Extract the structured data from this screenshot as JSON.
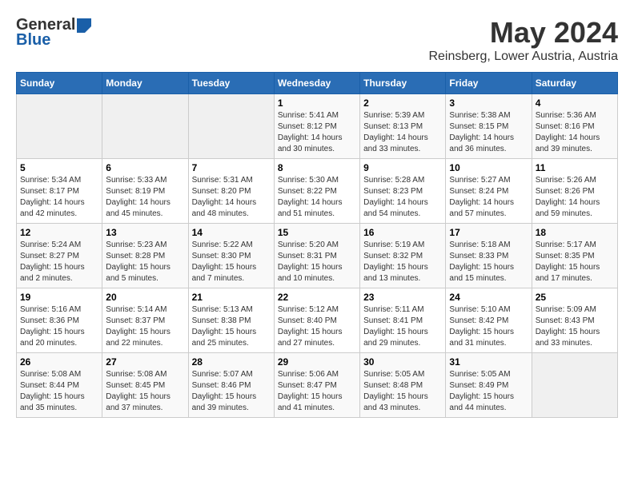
{
  "header": {
    "logo_general": "General",
    "logo_blue": "Blue",
    "title": "May 2024",
    "subtitle": "Reinsberg, Lower Austria, Austria"
  },
  "days_of_week": [
    "Sunday",
    "Monday",
    "Tuesday",
    "Wednesday",
    "Thursday",
    "Friday",
    "Saturday"
  ],
  "weeks": [
    [
      {
        "day": "",
        "info": ""
      },
      {
        "day": "",
        "info": ""
      },
      {
        "day": "",
        "info": ""
      },
      {
        "day": "1",
        "info": "Sunrise: 5:41 AM\nSunset: 8:12 PM\nDaylight: 14 hours\nand 30 minutes."
      },
      {
        "day": "2",
        "info": "Sunrise: 5:39 AM\nSunset: 8:13 PM\nDaylight: 14 hours\nand 33 minutes."
      },
      {
        "day": "3",
        "info": "Sunrise: 5:38 AM\nSunset: 8:15 PM\nDaylight: 14 hours\nand 36 minutes."
      },
      {
        "day": "4",
        "info": "Sunrise: 5:36 AM\nSunset: 8:16 PM\nDaylight: 14 hours\nand 39 minutes."
      }
    ],
    [
      {
        "day": "5",
        "info": "Sunrise: 5:34 AM\nSunset: 8:17 PM\nDaylight: 14 hours\nand 42 minutes."
      },
      {
        "day": "6",
        "info": "Sunrise: 5:33 AM\nSunset: 8:19 PM\nDaylight: 14 hours\nand 45 minutes."
      },
      {
        "day": "7",
        "info": "Sunrise: 5:31 AM\nSunset: 8:20 PM\nDaylight: 14 hours\nand 48 minutes."
      },
      {
        "day": "8",
        "info": "Sunrise: 5:30 AM\nSunset: 8:22 PM\nDaylight: 14 hours\nand 51 minutes."
      },
      {
        "day": "9",
        "info": "Sunrise: 5:28 AM\nSunset: 8:23 PM\nDaylight: 14 hours\nand 54 minutes."
      },
      {
        "day": "10",
        "info": "Sunrise: 5:27 AM\nSunset: 8:24 PM\nDaylight: 14 hours\nand 57 minutes."
      },
      {
        "day": "11",
        "info": "Sunrise: 5:26 AM\nSunset: 8:26 PM\nDaylight: 14 hours\nand 59 minutes."
      }
    ],
    [
      {
        "day": "12",
        "info": "Sunrise: 5:24 AM\nSunset: 8:27 PM\nDaylight: 15 hours\nand 2 minutes."
      },
      {
        "day": "13",
        "info": "Sunrise: 5:23 AM\nSunset: 8:28 PM\nDaylight: 15 hours\nand 5 minutes."
      },
      {
        "day": "14",
        "info": "Sunrise: 5:22 AM\nSunset: 8:30 PM\nDaylight: 15 hours\nand 7 minutes."
      },
      {
        "day": "15",
        "info": "Sunrise: 5:20 AM\nSunset: 8:31 PM\nDaylight: 15 hours\nand 10 minutes."
      },
      {
        "day": "16",
        "info": "Sunrise: 5:19 AM\nSunset: 8:32 PM\nDaylight: 15 hours\nand 13 minutes."
      },
      {
        "day": "17",
        "info": "Sunrise: 5:18 AM\nSunset: 8:33 PM\nDaylight: 15 hours\nand 15 minutes."
      },
      {
        "day": "18",
        "info": "Sunrise: 5:17 AM\nSunset: 8:35 PM\nDaylight: 15 hours\nand 17 minutes."
      }
    ],
    [
      {
        "day": "19",
        "info": "Sunrise: 5:16 AM\nSunset: 8:36 PM\nDaylight: 15 hours\nand 20 minutes."
      },
      {
        "day": "20",
        "info": "Sunrise: 5:14 AM\nSunset: 8:37 PM\nDaylight: 15 hours\nand 22 minutes."
      },
      {
        "day": "21",
        "info": "Sunrise: 5:13 AM\nSunset: 8:38 PM\nDaylight: 15 hours\nand 25 minutes."
      },
      {
        "day": "22",
        "info": "Sunrise: 5:12 AM\nSunset: 8:40 PM\nDaylight: 15 hours\nand 27 minutes."
      },
      {
        "day": "23",
        "info": "Sunrise: 5:11 AM\nSunset: 8:41 PM\nDaylight: 15 hours\nand 29 minutes."
      },
      {
        "day": "24",
        "info": "Sunrise: 5:10 AM\nSunset: 8:42 PM\nDaylight: 15 hours\nand 31 minutes."
      },
      {
        "day": "25",
        "info": "Sunrise: 5:09 AM\nSunset: 8:43 PM\nDaylight: 15 hours\nand 33 minutes."
      }
    ],
    [
      {
        "day": "26",
        "info": "Sunrise: 5:08 AM\nSunset: 8:44 PM\nDaylight: 15 hours\nand 35 minutes."
      },
      {
        "day": "27",
        "info": "Sunrise: 5:08 AM\nSunset: 8:45 PM\nDaylight: 15 hours\nand 37 minutes."
      },
      {
        "day": "28",
        "info": "Sunrise: 5:07 AM\nSunset: 8:46 PM\nDaylight: 15 hours\nand 39 minutes."
      },
      {
        "day": "29",
        "info": "Sunrise: 5:06 AM\nSunset: 8:47 PM\nDaylight: 15 hours\nand 41 minutes."
      },
      {
        "day": "30",
        "info": "Sunrise: 5:05 AM\nSunset: 8:48 PM\nDaylight: 15 hours\nand 43 minutes."
      },
      {
        "day": "31",
        "info": "Sunrise: 5:05 AM\nSunset: 8:49 PM\nDaylight: 15 hours\nand 44 minutes."
      },
      {
        "day": "",
        "info": ""
      }
    ]
  ]
}
